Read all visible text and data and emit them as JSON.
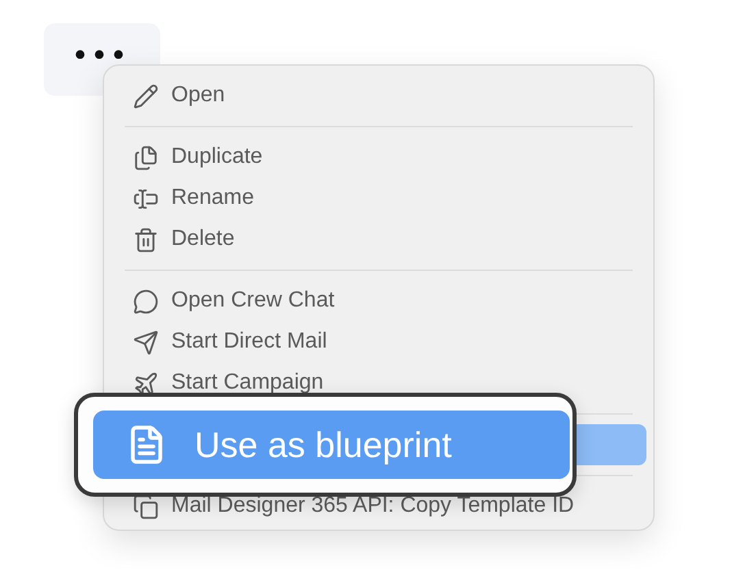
{
  "more_button": {
    "label": "•••"
  },
  "menu": {
    "groups": [
      [
        {
          "label": "Open",
          "selected": false,
          "kind": "item"
        }
      ],
      [
        {
          "label": "Duplicate",
          "selected": false,
          "kind": "item"
        },
        {
          "label": "Rename",
          "selected": false,
          "kind": "item"
        },
        {
          "label": "Delete",
          "selected": false,
          "kind": "item"
        }
      ],
      [
        {
          "label": "Open Crew Chat",
          "selected": false,
          "kind": "item"
        },
        {
          "label": "Start Direct Mail",
          "selected": false,
          "kind": "item"
        },
        {
          "label": "Start Campaign",
          "selected": false,
          "kind": "item"
        }
      ],
      [
        {
          "label": "Use as blueprint",
          "selected": true,
          "kind": "zoomed"
        }
      ],
      [
        {
          "label": "Mail Designer 365 API: Copy Template ID",
          "selected": false,
          "kind": "item"
        }
      ]
    ]
  }
}
